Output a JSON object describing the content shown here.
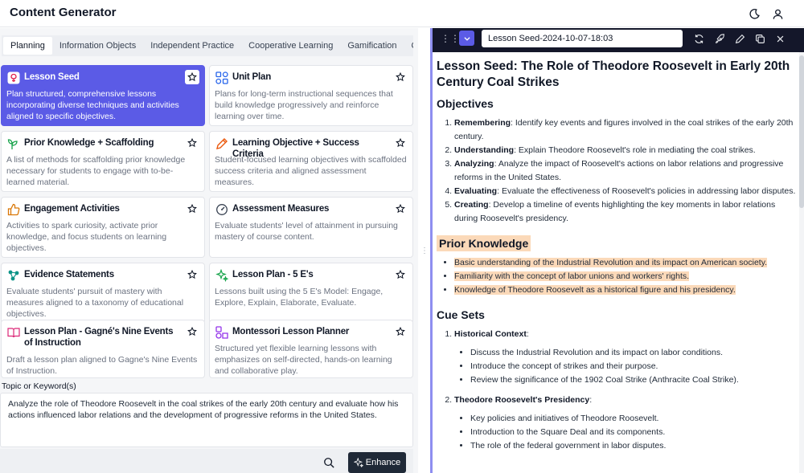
{
  "header": {
    "title": "Content Generator"
  },
  "tabs": [
    "Planning",
    "Information Objects",
    "Independent Practice",
    "Cooperative Learning",
    "Gamification",
    "Ques"
  ],
  "cards": [
    {
      "title": "Lesson Seed",
      "desc": "Plan structured, comprehensive lessons incorporating diverse techniques and activities aligned to specific objectives."
    },
    {
      "title": "Unit Plan",
      "desc": "Plans for long-term instructional sequences that build knowledge progressively and reinforce learning over time."
    },
    {
      "title": "Prior Knowledge + Scaffolding",
      "desc": "A list of methods for scaffolding prior knowledge necessary for students to engage with to-be-learned material."
    },
    {
      "title": "Learning Objective + Success Criteria",
      "desc": "Student-focused learning objectives with scaffolded success criteria and aligned assessment measures."
    },
    {
      "title": "Engagement Activities",
      "desc": "Activities to spark curiosity, activate prior knowledge, and focus students on learning objectives."
    },
    {
      "title": "Assessment Measures",
      "desc": "Evaluate students' level of attainment in pursuing mastery of course content."
    },
    {
      "title": "Evidence Statements",
      "desc": "Evaluate students' pursuit of mastery with measures aligned to a taxonomy of educational objectives."
    },
    {
      "title": "Lesson Plan - 5 E's",
      "desc": "Lessons built using the 5 E's Model: Engage, Explore, Explain, Elaborate, Evaluate."
    },
    {
      "title": "Lesson Plan - Gagné's Nine Events of Instruction",
      "desc": "Draft a lesson plan aligned to Gagne's Nine Events of Instruction."
    },
    {
      "title": "Montessori Lesson Planner",
      "desc": "Structured yet flexible learning lessons with emphasizes on self-directed, hands-on learning and collaborative play."
    }
  ],
  "topic": {
    "label": "Topic or Keyword(s)",
    "value": "Analyze the role of Theodore Roosevelt in the coal strikes of the early 20th century and evaluate how his actions influenced labor relations and the development of progressive reforms in the United States."
  },
  "enhance_label": "Enhance",
  "doc_name": "Lesson Seed-2024-10-07-18:03",
  "doc": {
    "title": "Lesson Seed: The Role of Theodore Roosevelt in Early 20th Century Coal Strikes",
    "objectives_heading": "Objectives",
    "objectives": [
      {
        "term": "Remembering",
        "text": ": Identify key events and figures involved in the coal strikes of the early 20th century."
      },
      {
        "term": "Understanding",
        "text": ": Explain Theodore Roosevelt's role in mediating the coal strikes."
      },
      {
        "term": "Analyzing",
        "text": ": Analyze the impact of Roosevelt's actions on labor relations and progressive reforms in the United States."
      },
      {
        "term": "Evaluating",
        "text": ": Evaluate the effectiveness of Roosevelt's policies in addressing labor disputes."
      },
      {
        "term": "Creating",
        "text": ": Develop a timeline of events highlighting the key moments in labor relations during Roosevelt's presidency."
      }
    ],
    "prior_heading": "Prior Knowledge",
    "prior": [
      "Basic understanding of the Industrial Revolution and its impact on American society.",
      "Familiarity with the concept of labor unions and workers' rights.",
      "Knowledge of Theodore Roosevelt as a historical figure and his presidency."
    ],
    "cue_heading": "Cue Sets",
    "cue1_title": "Historical Context",
    "cue1_items": [
      "Discuss the Industrial Revolution and its impact on labor conditions.",
      "Introduce the concept of strikes and their purpose.",
      "Review the significance of the 1902 Coal Strike (Anthracite Coal Strike)."
    ],
    "cue2_title": "Theodore Roosevelt's Presidency",
    "cue2_items": [
      "Key policies and initiatives of Theodore Roosevelt.",
      "Introduction to the Square Deal and its components.",
      "The role of the federal government in labor disputes."
    ]
  }
}
